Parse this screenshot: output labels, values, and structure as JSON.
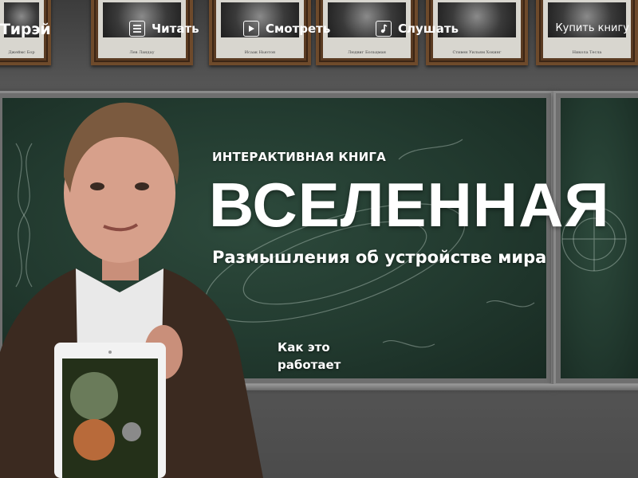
{
  "header": {
    "brand": "Тирэй",
    "nav": [
      {
        "label": "Читать",
        "icon": "read-icon"
      },
      {
        "label": "Смотреть",
        "icon": "play-icon"
      },
      {
        "label": "Слушать",
        "icon": "music-note-icon"
      }
    ],
    "buy_label": "Купить книгу"
  },
  "portraits": [
    "Джеймс Бор",
    "Лев Ландау",
    "Исаак Ньютон",
    "Людвиг Больцман",
    "Стивен Уильям Хокинг",
    "Никола Тесла"
  ],
  "hero": {
    "eyebrow": "ИНТЕРАКТИВНАЯ КНИГА",
    "title": "ВСЕЛЕННАЯ",
    "subtitle": "Размышления об устройстве мира",
    "how_it_works": "Как это работает"
  },
  "colors": {
    "board": "#223a2f",
    "wall": "#565656",
    "text": "#ffffff"
  }
}
